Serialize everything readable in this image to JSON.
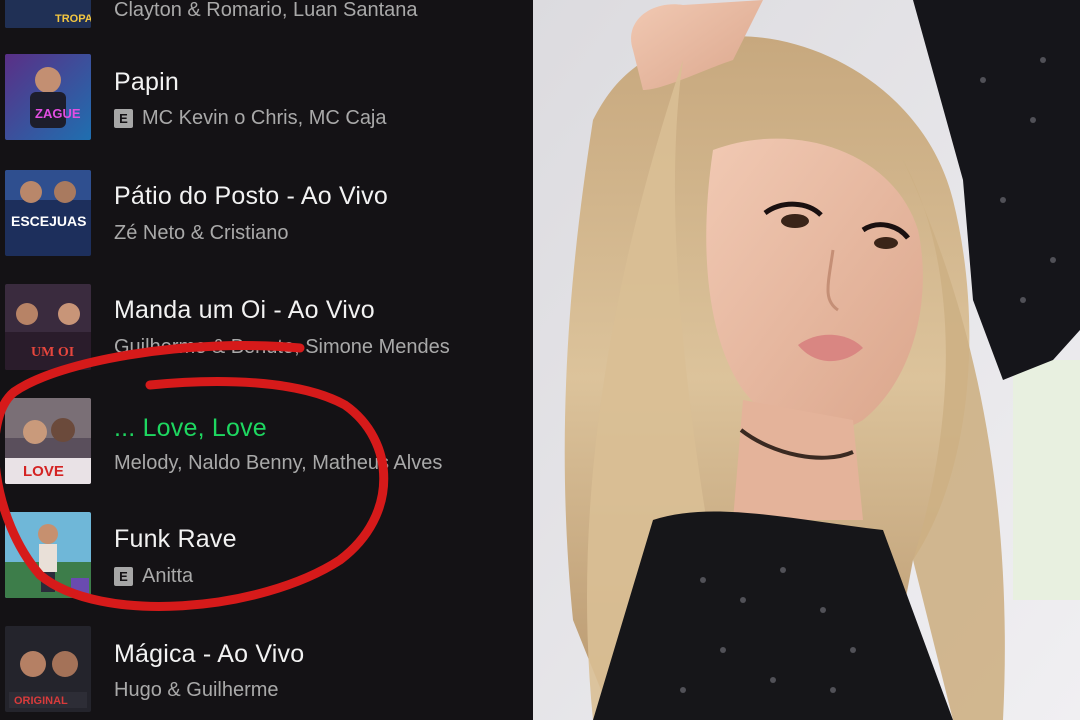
{
  "tracks": [
    {
      "title": "",
      "artist": "Clayton & Romario, Luan Santana",
      "explicit": false
    },
    {
      "title": "Papin",
      "artist": "MC Kevin o Chris, MC Caja",
      "explicit": true
    },
    {
      "title": "Pátio do Posto - Ao Vivo",
      "artist": "Zé Neto & Cristiano",
      "explicit": false
    },
    {
      "title": "Manda um Oi - Ao Vivo",
      "artist": "Guilherme & Benuto, Simone Mendes",
      "explicit": false
    },
    {
      "title": "... Love, Love",
      "artist": "Melody, Naldo Benny, Matheus Alves",
      "explicit": false,
      "playing": true
    },
    {
      "title": "Funk Rave",
      "artist": "Anitta",
      "explicit": true
    },
    {
      "title": "Mágica - Ao Vivo",
      "artist": "Hugo & Guilherme",
      "explicit": false
    }
  ],
  "explicit_badge": "E",
  "cover_art_text": {
    "papin": "ZAGUE",
    "patio": "ESCEJUAS",
    "manda": "UM OI",
    "love": "LOVE",
    "magica": "ORIGINAL"
  },
  "colors": {
    "background": "#141215",
    "playing": "#1ed760",
    "annotation": "#d61a1a"
  }
}
